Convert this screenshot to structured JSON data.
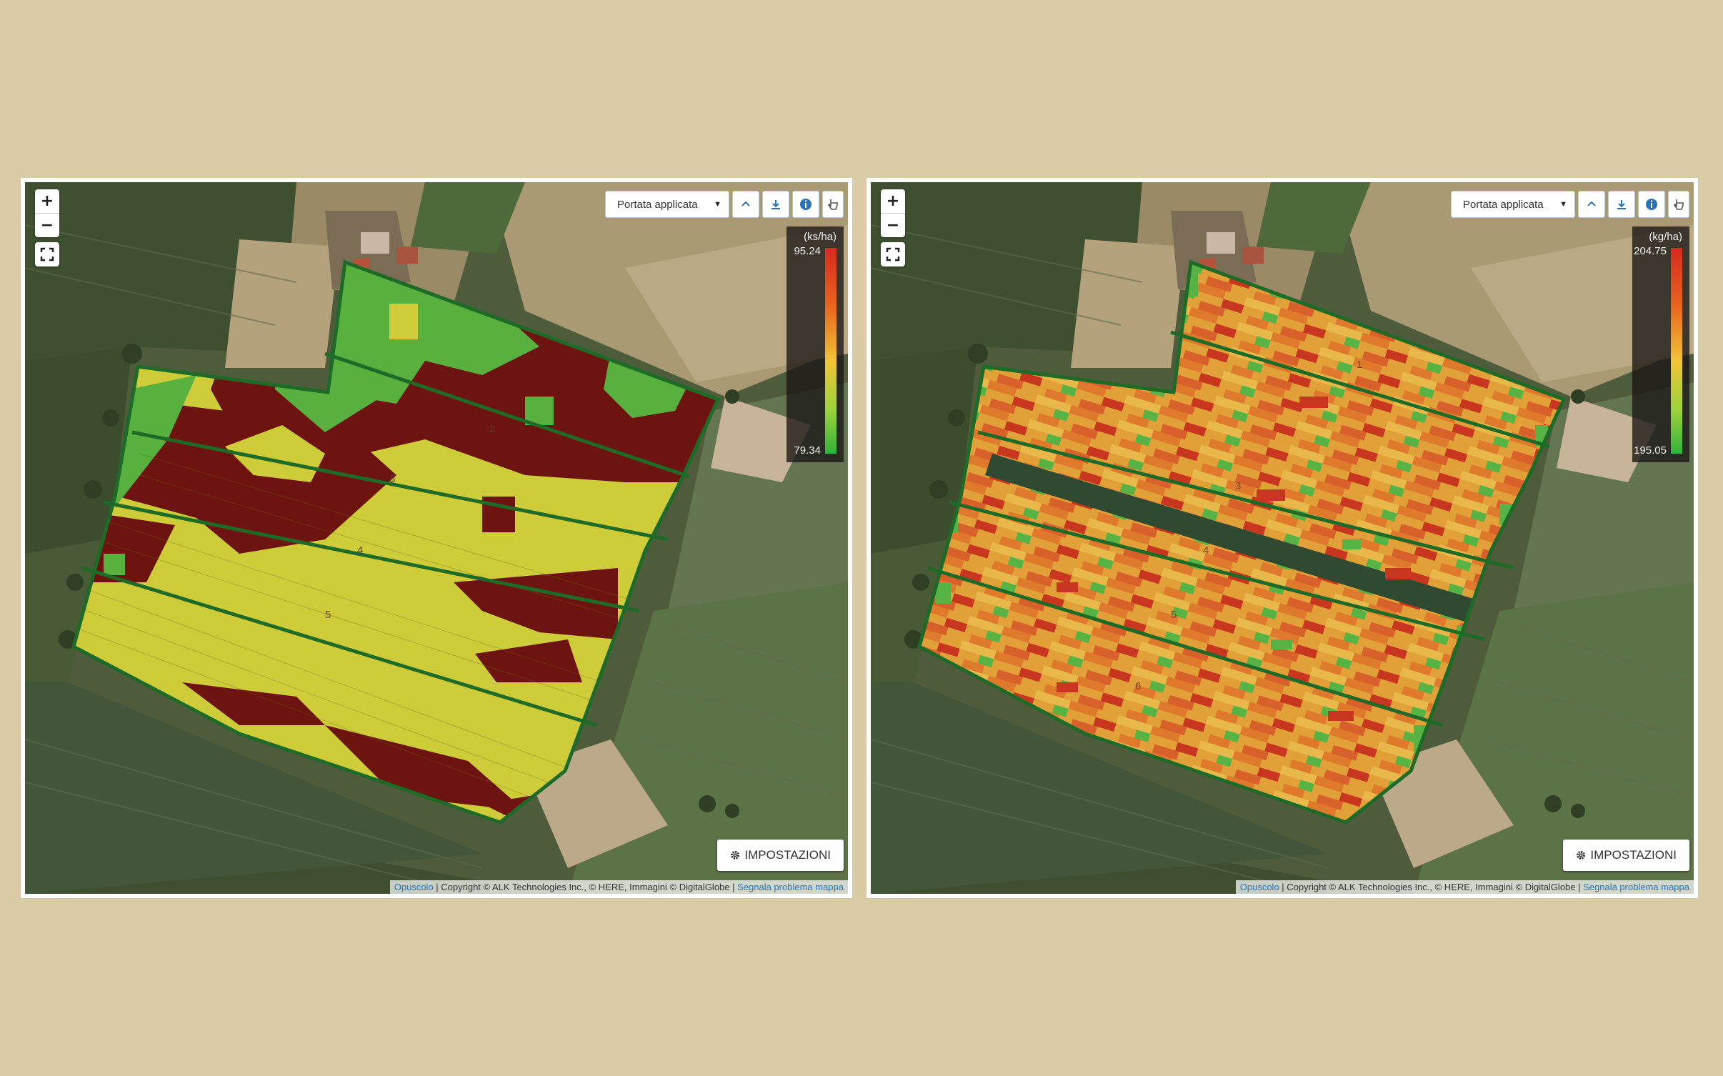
{
  "colors": {
    "page_background": "#d8cba5",
    "high": "#6e1410",
    "mid": "#cfcc3a",
    "low": "#58b03e",
    "red": "#c8361f",
    "orange": "#df7a2c",
    "amber": "#e1a038",
    "green": "#57b343",
    "field_outline": "#1d6b27"
  },
  "maps": [
    {
      "controls": {
        "zoom_in": "+",
        "zoom_out": "−",
        "layer_select": "Portata applicata",
        "settings": "IMPOSTAZIONI",
        "icons": [
          "plus-icon",
          "minus-icon",
          "fullscreen-icon",
          "chevron-up-icon",
          "download-icon",
          "info-icon",
          "pointer-icon",
          "gear-icon"
        ]
      },
      "legend": {
        "unit": "(ks/ha)",
        "max": "95.24",
        "min": "79.34"
      },
      "zone_labels": [
        "2",
        "3",
        "4",
        "5"
      ],
      "attribution": {
        "link1": "Opuscolo",
        "text": " | Copyright © ALK Technologies Inc., © HERE, Immagini © DigitalGlobe | ",
        "link2": "Segnala problema mappa"
      }
    },
    {
      "controls": {
        "zoom_in": "+",
        "zoom_out": "−",
        "layer_select": "Portata applicata",
        "settings": "IMPOSTAZIONI",
        "icons": [
          "plus-icon",
          "minus-icon",
          "fullscreen-icon",
          "chevron-up-icon",
          "download-icon",
          "info-icon",
          "pointer-icon",
          "gear-icon"
        ]
      },
      "legend": {
        "unit": "(kg/ha)",
        "max": "204.75",
        "min": "195.05"
      },
      "zone_labels": [
        "1",
        "3",
        "4",
        "5",
        "6"
      ],
      "attribution": {
        "link1": "Opuscolo",
        "text": " | Copyright © ALK Technologies Inc., © HERE, Immagini © DigitalGlobe | ",
        "link2": "Segnala problema mappa"
      }
    }
  ]
}
